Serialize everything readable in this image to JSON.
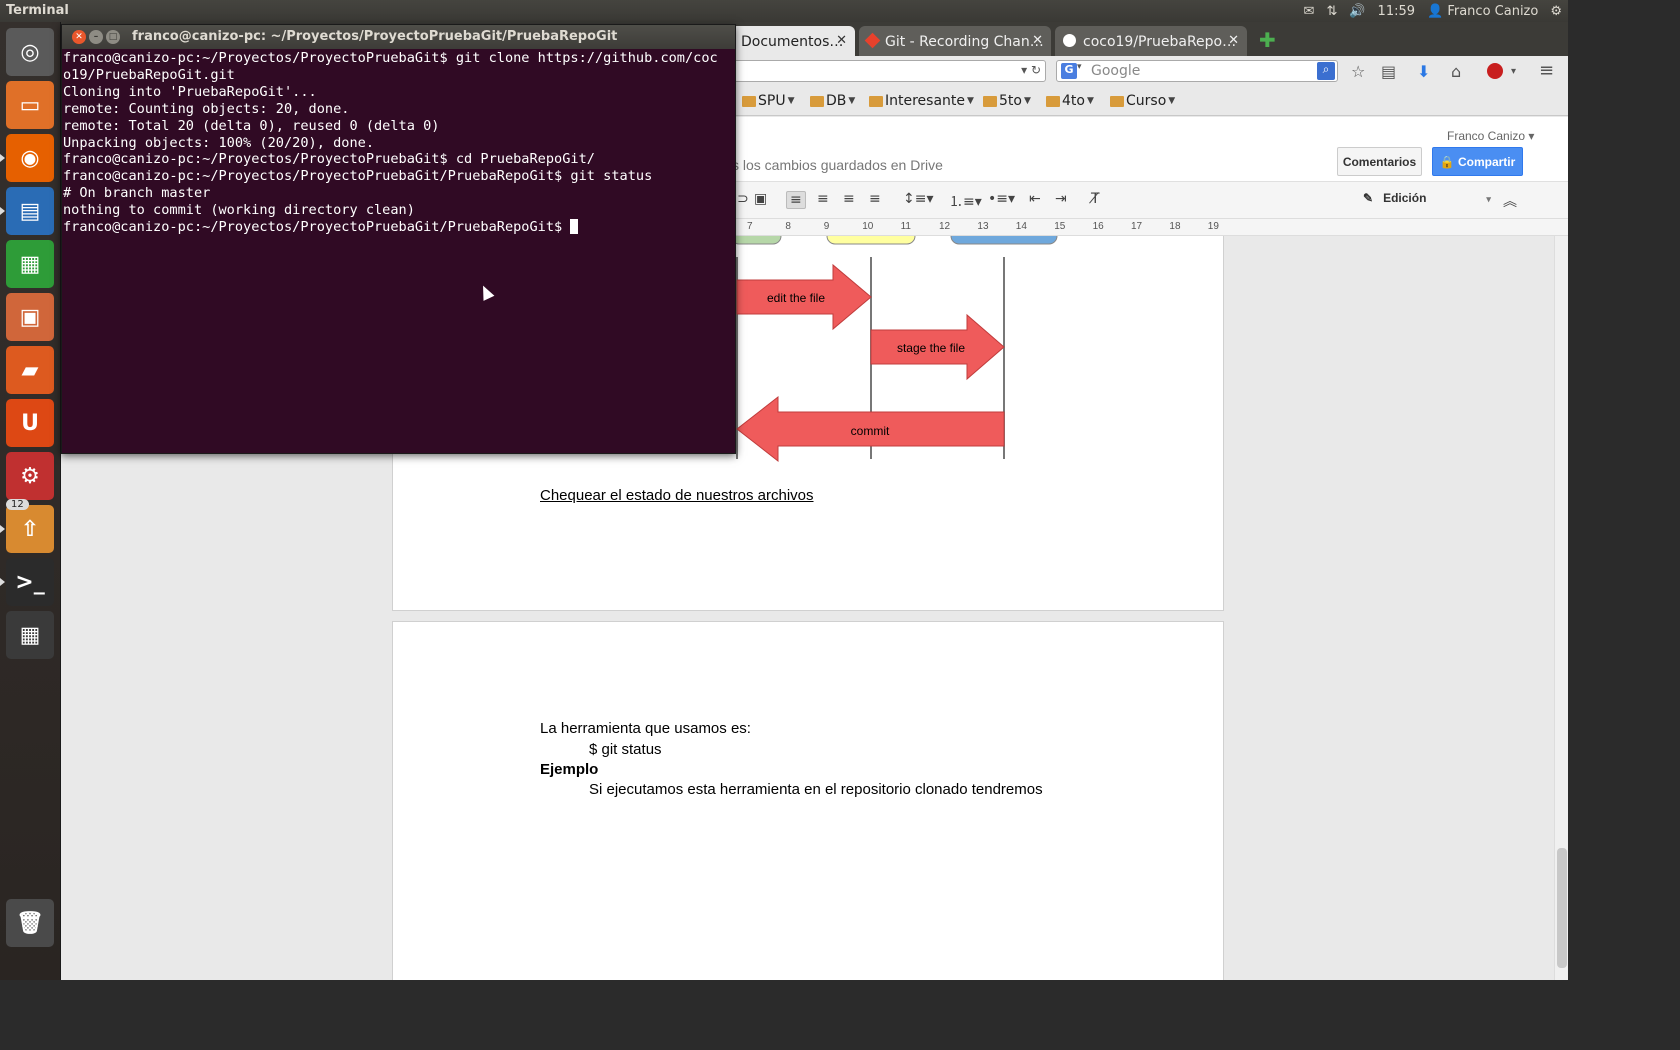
{
  "topbar": {
    "app_name": "Terminal",
    "time": "11:59",
    "user": "Franco Canizo",
    "icons": [
      "mail-icon",
      "network-icon",
      "volume-icon",
      "user-icon",
      "gear-icon"
    ]
  },
  "launcher": {
    "items": [
      {
        "name": "dash-home",
        "glyph": "◎",
        "color": "#5a5a5a"
      },
      {
        "name": "files",
        "glyph": "▭",
        "color": "#e07028"
      },
      {
        "name": "firefox",
        "glyph": "◉",
        "color": "#e66000"
      },
      {
        "name": "writer",
        "glyph": "▤",
        "color": "#2a6cb5"
      },
      {
        "name": "calc",
        "glyph": "▦",
        "color": "#2e9c38"
      },
      {
        "name": "impress",
        "glyph": "▣",
        "color": "#d0663a"
      },
      {
        "name": "software-center",
        "glyph": "▰",
        "color": "#dd5a1f"
      },
      {
        "name": "ubuntu-one",
        "glyph": "U",
        "color": "#dd4814"
      },
      {
        "name": "system-settings",
        "glyph": "⚙",
        "color": "#c03030"
      },
      {
        "name": "update-manager",
        "glyph": "⇧",
        "color": "#d88a30",
        "badge": "12"
      },
      {
        "name": "terminal",
        "glyph": ">_",
        "color": "#2b2b2b"
      },
      {
        "name": "workspace-switcher",
        "glyph": "▦",
        "color": "#3a3a3a"
      },
      {
        "name": "trash",
        "glyph": "🗑",
        "color": "#4a4a4a"
      }
    ]
  },
  "browser": {
    "tabs": [
      {
        "label": "Documentos…",
        "active": true
      },
      {
        "label": "Git - Recording Chan…",
        "active": false
      },
      {
        "label": "coco19/PruebaRepo…",
        "active": false
      }
    ],
    "search_placeholder": "Google",
    "bookmarks": [
      "SPU",
      "DB",
      "Interesante",
      "5to",
      "4to",
      "Curso"
    ]
  },
  "docs": {
    "saved_status": "s los cambios guardados en Drive",
    "user": "Franco Canizo",
    "comments_label": "Comentarios",
    "share_label": "Compartir",
    "edit_mode": "Edición",
    "ruler_ticks": [
      "7",
      "8",
      "9",
      "10",
      "11",
      "12",
      "13",
      "14",
      "15",
      "16",
      "17",
      "18",
      "19"
    ],
    "diagram": {
      "edit_label": "edit the file",
      "stage_label": "stage the file",
      "commit_label": "commit"
    },
    "link_text": "Chequear el estado de nuestros archivos",
    "p1": "La herramienta que usamos es:",
    "p2": "$ git status",
    "p3": "Ejemplo",
    "p4": "Si ejecutamos esta herramienta en el repositorio clonado tendremos"
  },
  "terminal": {
    "title": "franco@canizo-pc: ~/Proyectos/ProyectoPruebaGit/PruebaRepoGit",
    "lines": [
      "franco@canizo-pc:~/Proyectos/ProyectoPruebaGit$ git clone https://github.com/coc",
      "o19/PruebaRepoGit.git",
      "Cloning into 'PruebaRepoGit'...",
      "remote: Counting objects: 20, done.",
      "remote: Total 20 (delta 0), reused 0 (delta 0)",
      "Unpacking objects: 100% (20/20), done.",
      "franco@canizo-pc:~/Proyectos/ProyectoPruebaGit$ cd PruebaRepoGit/",
      "franco@canizo-pc:~/Proyectos/ProyectoPruebaGit/PruebaRepoGit$ git status",
      "# On branch master",
      "nothing to commit (working directory clean)"
    ],
    "prompt": "franco@canizo-pc:~/Proyectos/ProyectoPruebaGit/PruebaRepoGit$ "
  }
}
